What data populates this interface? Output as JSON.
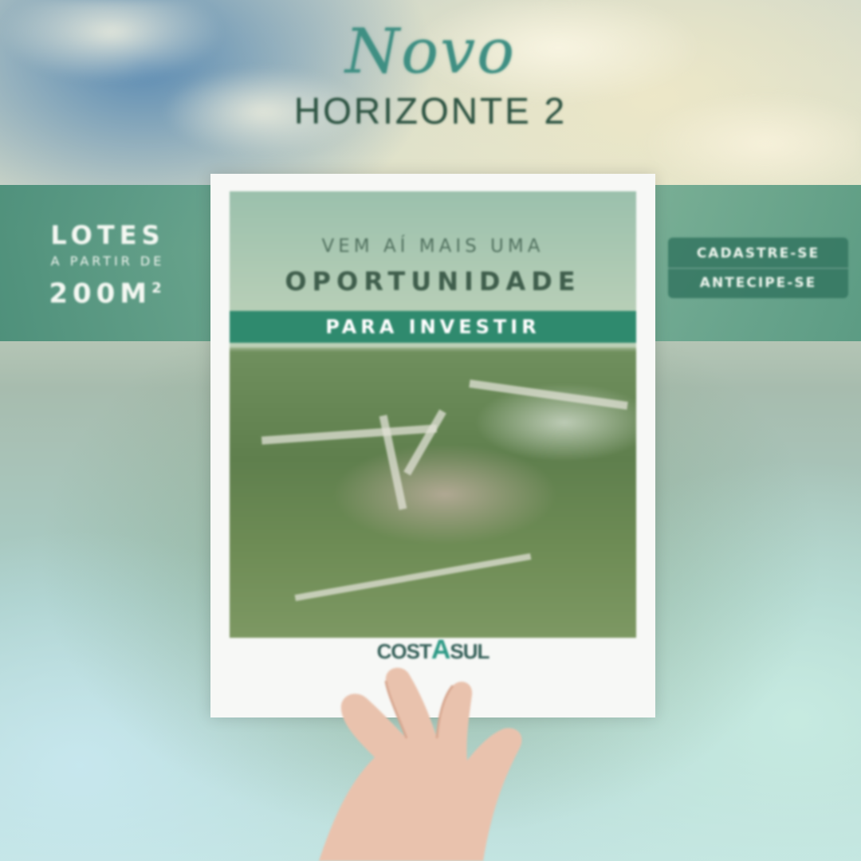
{
  "logo": {
    "script": "Novo",
    "subtitle": "HORIZONTE 2"
  },
  "lotes": {
    "title": "LOTES",
    "from": "A PARTIR DE",
    "size": "200M",
    "size_sup": "2"
  },
  "cta": {
    "register": "CADASTRE-SE",
    "anticipate": "ANTECIPE-SE"
  },
  "card": {
    "headline1": "VEM AÍ MAIS UMA",
    "headline2": "OPORTUNIDADE",
    "ribbon": "PARA INVESTIR",
    "brand_left": "COST",
    "brand_a": "A",
    "brand_right": "SUL"
  },
  "colors": {
    "accent": "#2f8a6e",
    "logo": "#3f8f83",
    "band": "#5c9e86"
  }
}
